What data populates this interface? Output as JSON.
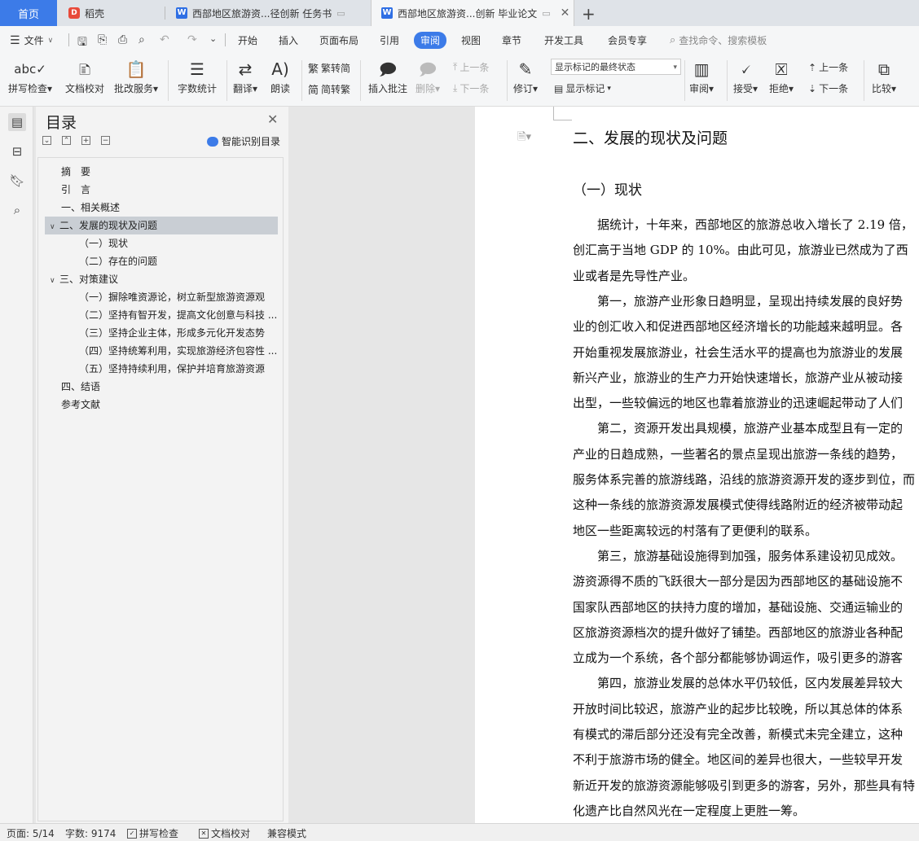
{
  "tabs": {
    "home": "首页",
    "daoke": "稻壳",
    "doc1": "西部地区旅游资...径创新 任务书",
    "doc2": "西部地区旅游资...创新 毕业论文"
  },
  "menu": {
    "file": "文件",
    "items": [
      "开始",
      "插入",
      "页面布局",
      "引用",
      "审阅",
      "视图",
      "章节",
      "开发工具",
      "会员专享"
    ],
    "search": "查找命令、搜索模板"
  },
  "ribbon": {
    "spellcheck": "拼写检查",
    "doc_proof": "文档校对",
    "revise_service": "批改服务",
    "word_count": "字数统计",
    "translate": "翻译",
    "read_aloud": "朗读",
    "trad_to_simp": "繁转简",
    "simp_to_trad": "简转繁",
    "insert_comment": "插入批注",
    "delete": "删除",
    "prev_comment": "上一条",
    "next_comment": "下一条",
    "track_changes": "修订",
    "display_mode": "显示标记的最终状态",
    "show_markup": "显示标记",
    "review": "审阅",
    "accept": "接受",
    "reject": "拒绝",
    "prev_change": "上一条",
    "next_change": "下一条",
    "compare": "比较"
  },
  "toc": {
    "title": "目录",
    "smart": "智能识别目录",
    "items": [
      "摘　要",
      "引　言",
      "一、相关概述",
      "二、发展的现状及问题",
      "（一）现状",
      "（二）存在的问题",
      "三、对策建议",
      "（一）摒除唯资源论，树立新型旅游资源观",
      "（二）坚持有智开发，提高文化创意与科技 ...",
      "（三）坚持企业主体，形成多元化开发态势",
      "（四）坚持统筹利用，实现旅游经济包容性 ...",
      "（五）坚持持续利用，保护并培育旅游资源",
      "四、结语",
      "参考文献"
    ]
  },
  "doc": {
    "heading": "二、发展的现状及问题",
    "subheading": "（一）现状",
    "lines": [
      "　　据统计，十年来，西部地区的旅游总收入增长了 2.19 倍，",
      "创汇高于当地 GDP 的 10%。由此可见，旅游业已然成为了西",
      "业或者是先导性产业。",
      "　　第一，旅游产业形象日趋明显，呈现出持续发展的良好势",
      "业的创汇收入和促进西部地区经济增长的功能越来越明显。各",
      "开始重视发展旅游业，社会生活水平的提高也为旅游业的发展",
      "新兴产业，旅游业的生产力开始快速增长，旅游产业从被动接",
      "出型，一些较偏远的地区也靠着旅游业的迅速崛起带动了人们",
      "　　第二，资源开发出具规模，旅游产业基本成型且有一定的",
      "产业的日趋成熟，一些著名的景点呈现出旅游一条线的趋势，",
      "服务体系完善的旅游线路，沿线的旅游资源开发的逐步到位，而",
      "这种一条线的旅游资源发展模式使得线路附近的经济被带动起",
      "地区一些距离较远的村落有了更便利的联系。",
      "　　第三，旅游基础设施得到加强，服务体系建设初见成效。",
      "游资源得不质的飞跃很大一部分是因为西部地区的基础设施不",
      "国家队西部地区的扶持力度的增加，基础设施、交通运输业的",
      "区旅游资源档次的提升做好了铺垫。西部地区的旅游业各种配",
      "立成为一个系统，各个部分都能够协调运作，吸引更多的游客",
      "　　第四，旅游业发展的总体水平仍较低，区内发展差异较大",
      "开放时间比较迟，旅游产业的起步比较晚，所以其总体的体系",
      "有模式的滞后部分还没有完全改善，新模式未完全建立，这种",
      "不利于旅游市场的健全。地区间的差异也很大，一些较早开发",
      "新近开发的旅游资源能够吸引到更多的游客，另外，那些具有特",
      "化遗产比自然风光在一定程度上更胜一筹。"
    ]
  },
  "status": {
    "page": "页面: 5/14",
    "words": "字数: 9174",
    "spell": "拼写检查",
    "proof": "文档校对",
    "compat": "兼容模式"
  },
  "colors": {
    "accent": "#3c7be8",
    "toc_selected": "#c9ced4"
  }
}
